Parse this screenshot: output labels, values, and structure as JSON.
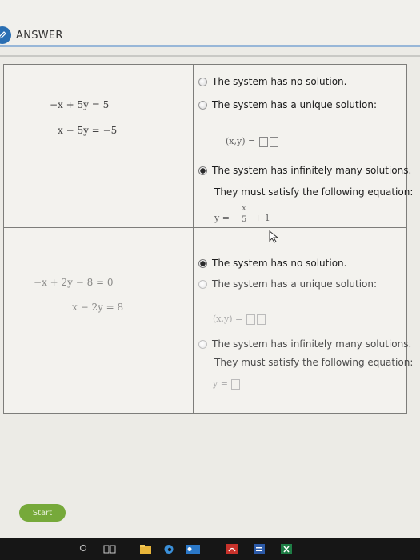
{
  "header": {
    "title": "ANSWER"
  },
  "problems": [
    {
      "equations": [
        "−x + 5y  =  5",
        "x − 5y  =  −5"
      ],
      "options": [
        {
          "label": "The system has no solution.",
          "selected": false
        },
        {
          "label": "The system has a unique solution:",
          "selected": false,
          "detail": "(x,y) ="
        },
        {
          "label": "The system has infinitely many solutions.",
          "selected": true,
          "detail": "They must satisfy the following equation:",
          "equation": {
            "lhs": "y =",
            "numerator": "x",
            "denominator": "5",
            "tail": "+ 1"
          }
        }
      ]
    },
    {
      "equations": [
        "−x + 2y − 8  =  0",
        "x − 2y  =  8"
      ],
      "options": [
        {
          "label": "The system has no solution.",
          "selected": true
        },
        {
          "label": "The system has a unique solution:",
          "selected": false,
          "detail": "(x,y) ="
        },
        {
          "label": "The system has infinitely many solutions.",
          "selected": false,
          "detail": "They must satisfy the following equation:",
          "equation": {
            "lhs": "y ="
          }
        }
      ]
    }
  ],
  "footer": {
    "start_label": "Start"
  },
  "icons": {
    "badge": "pencil-icon",
    "taskbar": [
      "search-icon",
      "task-view-icon",
      "file-explorer-icon",
      "edge-icon",
      "outlook-icon",
      "pdf-icon",
      "word-icon",
      "excel-icon"
    ]
  },
  "colors": {
    "accent": "#2b6fb3",
    "start": "#76a93a",
    "taskbar": "#161616"
  }
}
